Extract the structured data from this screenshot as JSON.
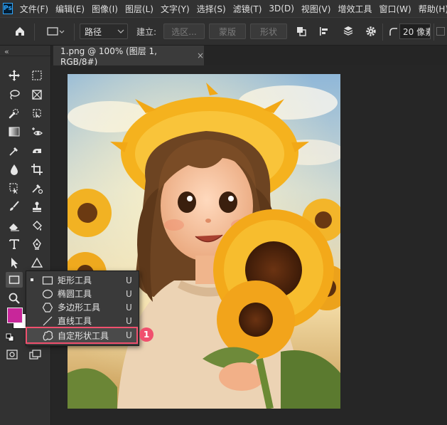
{
  "app": {
    "logo": "Ps"
  },
  "menu": [
    "文件(F)",
    "编辑(E)",
    "图像(I)",
    "图层(L)",
    "文字(Y)",
    "选择(S)",
    "滤镜(T)",
    "3D(D)",
    "视图(V)",
    "增效工具",
    "窗口(W)",
    "帮助(H)"
  ],
  "options": {
    "mode_select": "路径",
    "make_label": "建立:",
    "selection_btn": "选区...",
    "mask_btn": "蒙版",
    "shape_btn": "形状",
    "radius_value": "20 像素"
  },
  "panel_collapse": "«",
  "document": {
    "tab_title": "1.png @ 100% (图层 1, RGB/8#)",
    "close_glyph": "×"
  },
  "colors": {
    "foreground": "#c8269a",
    "background": "#ffffff",
    "highlight": "#f0506e",
    "ps_blue": "#31a8ff"
  },
  "flyout": {
    "items": [
      {
        "label": "矩形工具",
        "key": "U",
        "icon": "rectangle-icon",
        "selected": true
      },
      {
        "label": "椭圆工具",
        "key": "U",
        "icon": "ellipse-icon",
        "selected": false
      },
      {
        "label": "多边形工具",
        "key": "U",
        "icon": "polygon-icon",
        "selected": false
      },
      {
        "label": "直线工具",
        "key": "U",
        "icon": "line-icon",
        "selected": false
      },
      {
        "label": "自定形状工具",
        "key": "U",
        "icon": "custom-shape-icon",
        "selected": false,
        "highlighted": true
      }
    ],
    "step_badge": "1"
  }
}
